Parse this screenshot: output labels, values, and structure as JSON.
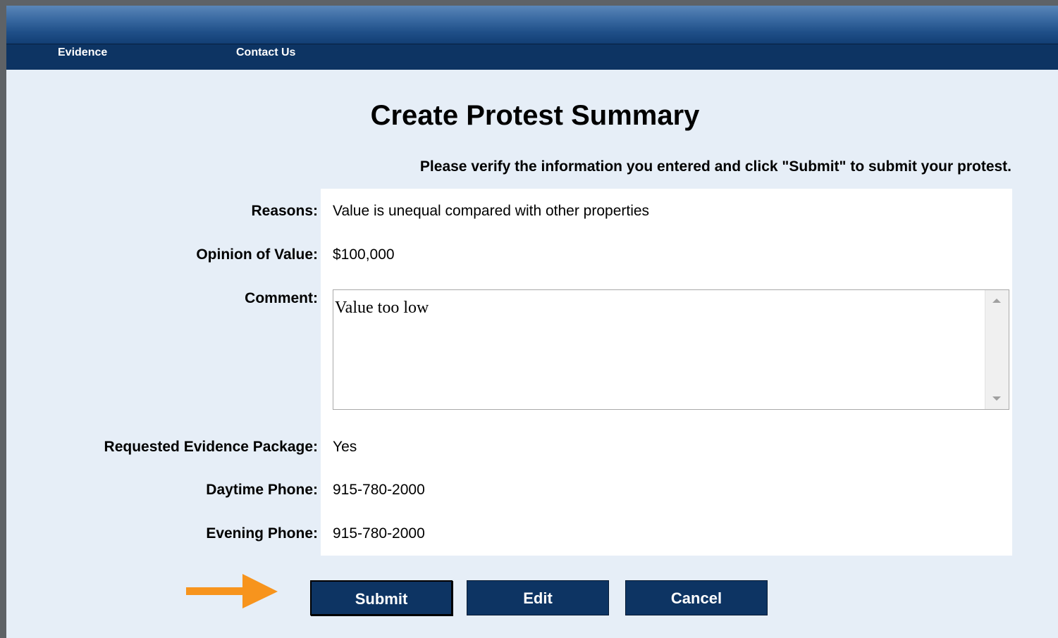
{
  "nav": {
    "items": [
      "Evidence",
      "Contact Us"
    ]
  },
  "page": {
    "title": "Create Protest Summary",
    "instructions": "Please verify the information you entered and click \"Submit\" to submit your protest."
  },
  "summary": {
    "reasons_label": "Reasons:",
    "reasons_value": "Value is unequal compared with other properties",
    "opinion_label": "Opinion of Value:",
    "opinion_value": "$100,000",
    "comment_label": "Comment:",
    "comment_value": "Value too low",
    "evidence_label": "Requested Evidence Package:",
    "evidence_value": "Yes",
    "daytime_label": "Daytime Phone:",
    "daytime_value": "915-780-2000",
    "evening_label": "Evening Phone:",
    "evening_value": "915-780-2000"
  },
  "buttons": {
    "submit": "Submit",
    "edit": "Edit",
    "cancel": "Cancel"
  },
  "colors": {
    "nav_background": "#0d3463",
    "page_background": "#e6eef7",
    "button_background": "#0d3463",
    "arrow": "#f7941d"
  },
  "annotation": {
    "icon": "arrow-right-icon"
  }
}
